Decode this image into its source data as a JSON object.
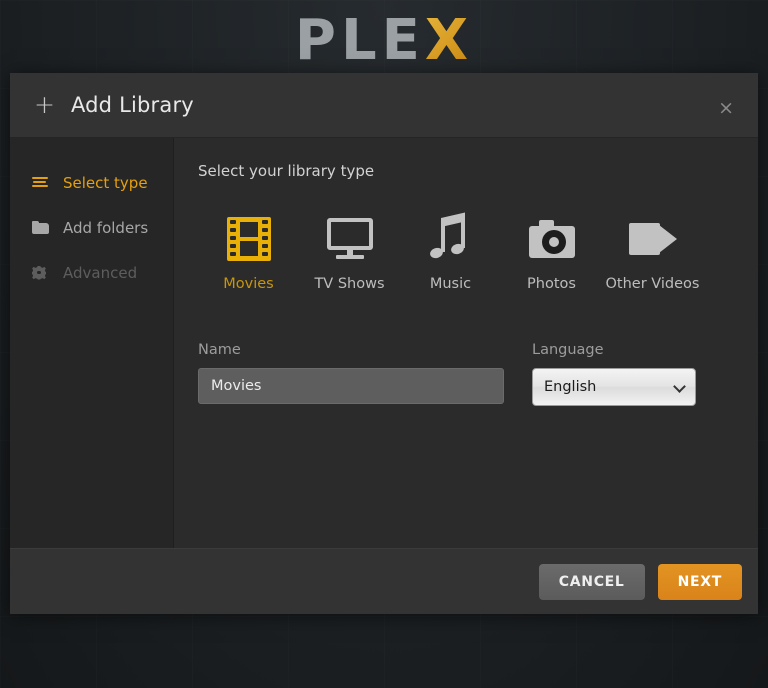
{
  "backdrop": {
    "logo_prefix": "PLE",
    "logo_accent": "X",
    "accent_color": "#d8a01b"
  },
  "dialog": {
    "title": "Add Library",
    "plus_icon": "+",
    "close_icon": "×"
  },
  "sidebar": {
    "items": [
      {
        "label": "Select type",
        "icon": "list-icon",
        "state": "active"
      },
      {
        "label": "Add folders",
        "icon": "folder-icon",
        "state": "normal"
      },
      {
        "label": "Advanced",
        "icon": "gear-icon",
        "state": "disabled"
      }
    ]
  },
  "content": {
    "heading": "Select your library type",
    "types": [
      {
        "label": "Movies",
        "icon": "film-strip-icon",
        "selected": true
      },
      {
        "label": "TV Shows",
        "icon": "television-icon",
        "selected": false
      },
      {
        "label": "Music",
        "icon": "music-note-icon",
        "selected": false
      },
      {
        "label": "Photos",
        "icon": "camera-icon",
        "selected": false
      },
      {
        "label": "Other Videos",
        "icon": "video-camera-icon",
        "selected": false
      }
    ],
    "fields": {
      "name_label": "Name",
      "name_value": "Movies",
      "name_placeholder": "Name",
      "language_label": "Language",
      "language_value": "English",
      "language_options": [
        "English"
      ]
    }
  },
  "footer": {
    "cancel_label": "CANCEL",
    "next_label": "NEXT",
    "next_color": "#e5a00d"
  }
}
